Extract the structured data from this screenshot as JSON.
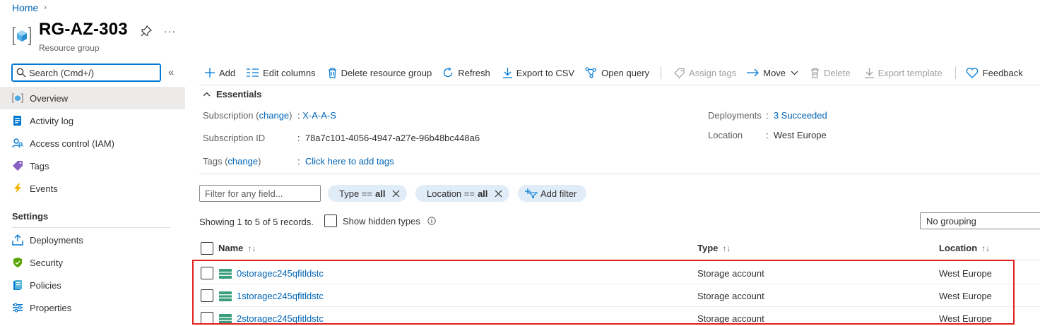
{
  "breadcrumb": {
    "home": "Home",
    "separator": "›"
  },
  "header": {
    "title": "RG-AZ-303",
    "subtitle": "Resource group",
    "more": "···",
    "icon": "resource-group-icon"
  },
  "sidebar": {
    "search_placeholder": "Search (Cmd+/)",
    "collapse": "«",
    "items": [
      {
        "label": "Overview",
        "icon": "overview-icon"
      },
      {
        "label": "Activity log",
        "icon": "activity-log-icon"
      },
      {
        "label": "Access control (IAM)",
        "icon": "iam-icon"
      },
      {
        "label": "Tags",
        "icon": "tag-icon"
      },
      {
        "label": "Events",
        "icon": "lightning-icon"
      }
    ],
    "settings_heading": "Settings",
    "settings_items": [
      {
        "label": "Deployments",
        "icon": "deployments-icon"
      },
      {
        "label": "Security",
        "icon": "shield-icon"
      },
      {
        "label": "Policies",
        "icon": "policies-icon"
      },
      {
        "label": "Properties",
        "icon": "properties-icon"
      }
    ]
  },
  "toolbar": {
    "add": "Add",
    "edit_columns": "Edit columns",
    "delete_rg": "Delete resource group",
    "refresh": "Refresh",
    "export_csv": "Export to CSV",
    "open_query": "Open query",
    "assign_tags": "Assign tags",
    "move": "Move",
    "delete": "Delete",
    "export_template": "Export template",
    "feedback": "Feedback"
  },
  "essentials": {
    "heading": "Essentials",
    "subscription_label": "Subscription",
    "change": "change",
    "subscription_value": "X-A-A-S",
    "subscription_id_label": "Subscription ID",
    "subscription_id_value": "78a7c101-4056-4947-a27e-96b48bc448a6",
    "tags_label": "Tags",
    "tags_value": "Click here to add tags",
    "deployments_label": "Deployments",
    "deployments_value": "3 Succeeded",
    "location_label": "Location",
    "location_value": "West Europe"
  },
  "filters": {
    "placeholder": "Filter for any field...",
    "type_pill": {
      "label": "Type ==",
      "value": "all"
    },
    "location_pill": {
      "label": "Location ==",
      "value": "all"
    },
    "add_filter": "Add filter"
  },
  "records_text": "Showing 1 to 5 of 5 records.",
  "show_hidden_types": "Show hidden types",
  "grouping": "No grouping",
  "table": {
    "columns": {
      "name": "Name",
      "type": "Type",
      "location": "Location"
    },
    "rows": [
      {
        "name": "0storagec245qfitldstc",
        "type": "Storage account",
        "location": "West Europe"
      },
      {
        "name": "1storagec245qfitldstc",
        "type": "Storage account",
        "location": "West Europe"
      },
      {
        "name": "2storagec245qfitldstc",
        "type": "Storage account",
        "location": "West Europe"
      }
    ]
  },
  "colors": {
    "link": "#0064b4",
    "accent": "#0078d4",
    "highlight": "#e0201e",
    "pill_bg": "#e0ecf8",
    "active_nav": "#edebe9"
  }
}
